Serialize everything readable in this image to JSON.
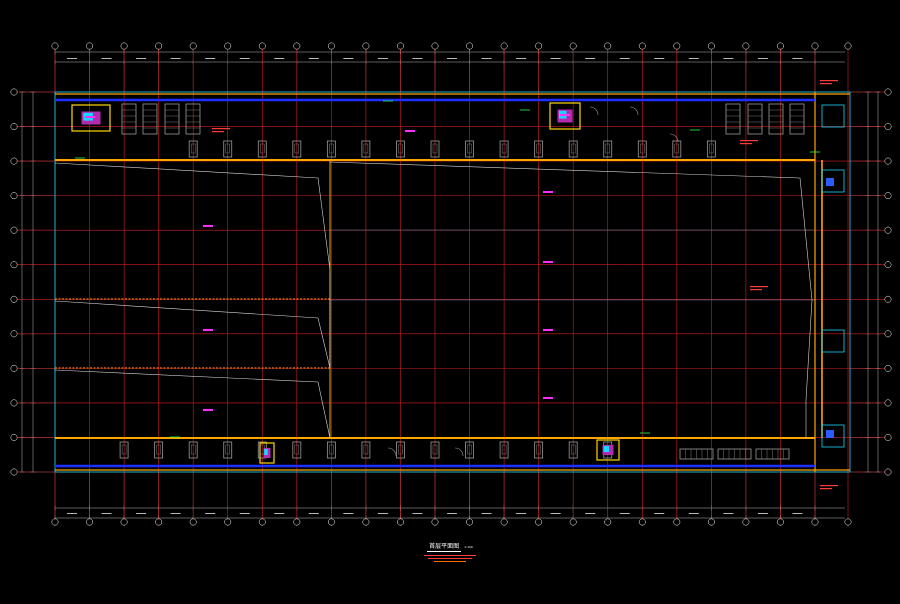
{
  "colors": {
    "background": "#000000",
    "grid": "#d11f1f",
    "ruler": "#b8b8b8",
    "wall": "#ffa500",
    "corridor": "#1f2fff",
    "label": "#ff2dff",
    "note": "#ff3b3b",
    "fixture": "#9a9a9a",
    "partition": "#d8d8d8",
    "green": "#22ff44",
    "cyan": "#18d6ff",
    "white": "#ffffff"
  },
  "drawing": {
    "grid_columns": 23,
    "grid_rows": 12,
    "title": "首层平面图",
    "scale": "1:100"
  }
}
